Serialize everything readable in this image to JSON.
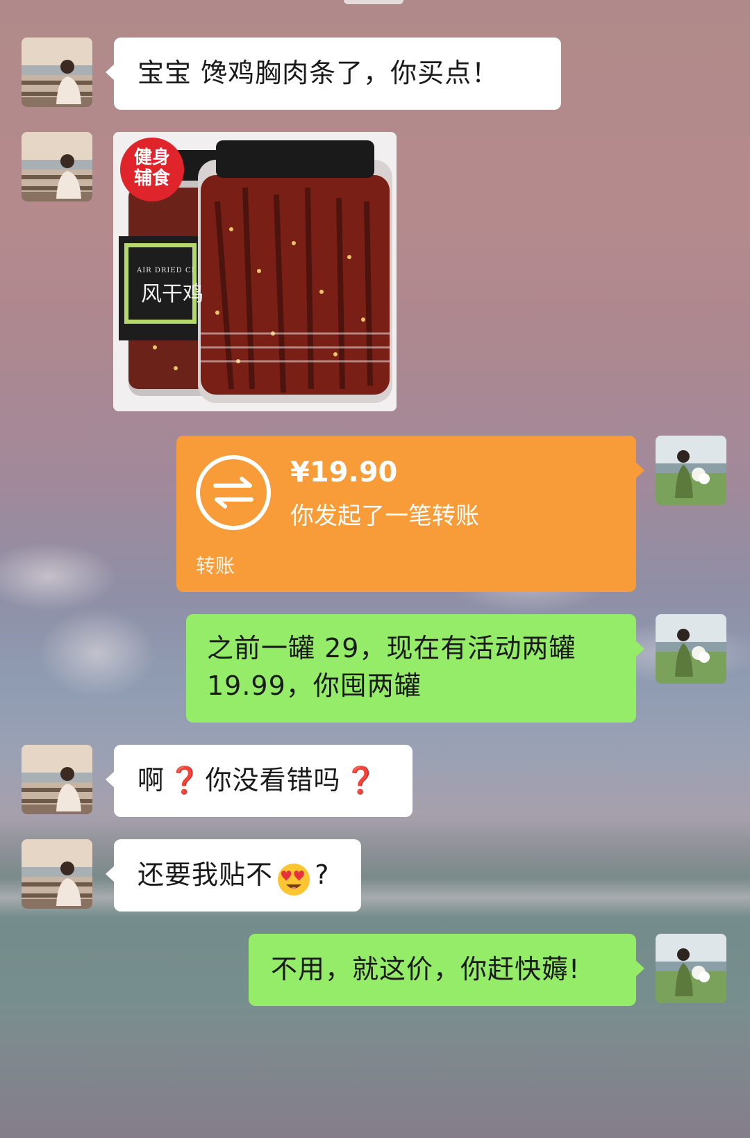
{
  "messages": [
    {
      "side": "left",
      "text": "宝宝 馋鸡胸肉条了，你买点！"
    },
    {
      "side": "left",
      "type": "image",
      "badge": [
        "健身",
        "辅食"
      ],
      "label_en": "AIR DRIED CI",
      "label_cn": "风干鸡"
    },
    {
      "side": "right",
      "type": "transfer",
      "amount": "¥19.90",
      "desc": "你发起了一笔转账",
      "label": "转账"
    },
    {
      "side": "right",
      "line1": "之前一罐 29，现在有活动两罐",
      "line2": "19.99，你囤两罐"
    },
    {
      "side": "left",
      "part1": "啊",
      "q1": "❓",
      "part2": "你没看错吗",
      "q2": "❓"
    },
    {
      "side": "left",
      "part1": "还要我贴不",
      "part2": "?"
    },
    {
      "side": "right",
      "text": "不用，就这价，你赶快薅!"
    }
  ],
  "colors": {
    "white_bubble": "#ffffff",
    "green_bubble": "#95ec69",
    "transfer_bubble": "#f79c38",
    "badge_red": "#e0242b",
    "label_green": "#b5d86a"
  },
  "icons": [
    "avatar-girl-pier",
    "avatar-girl-field",
    "transfer-arrows-icon",
    "heart-eyes-emoji-icon",
    "red-question-icon"
  ]
}
